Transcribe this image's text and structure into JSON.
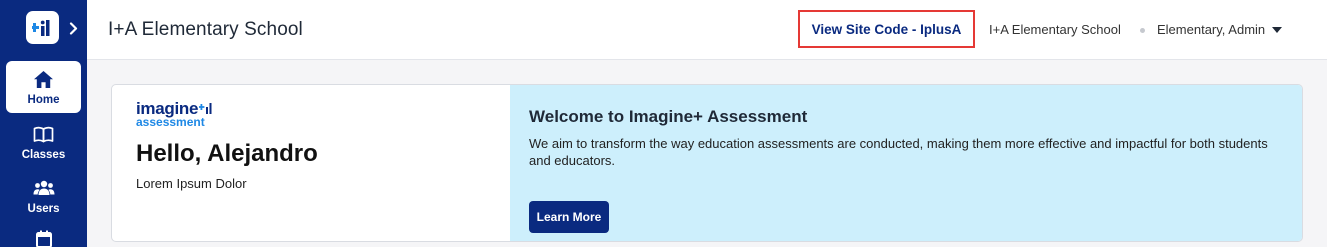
{
  "sidebar": {
    "expand_icon": "chevron-right-icon",
    "logo_icon": "imagine-plus-logo-icon",
    "items": [
      {
        "label": "Home",
        "icon": "home-icon",
        "active": true
      },
      {
        "label": "Classes",
        "icon": "book-icon",
        "active": false
      },
      {
        "label": "Users",
        "icon": "users-icon",
        "active": false
      },
      {
        "label": "",
        "icon": "calendar-icon",
        "active": false
      }
    ]
  },
  "header": {
    "title": "I+A Elementary School",
    "site_code_button": "View Site Code - IplusA",
    "school_name": "I+A Elementary School",
    "user_menu": "Elementary, Admin"
  },
  "welcome_card": {
    "brand_line1": "imagine",
    "brand_line2": "assessment",
    "greeting": "Hello, Alejandro",
    "subtitle": "Lorem Ipsum Dolor",
    "heading": "Welcome to Imagine+ Assessment",
    "description": "We aim to transform the way education assessments are conducted, making them more effective and impactful for both students and educators.",
    "cta_label": "Learn More"
  },
  "colors": {
    "rail": "#0a2a80",
    "accent_blue": "#1e88e5",
    "banner": "#cdeffc",
    "highlight_border": "#e53935"
  }
}
